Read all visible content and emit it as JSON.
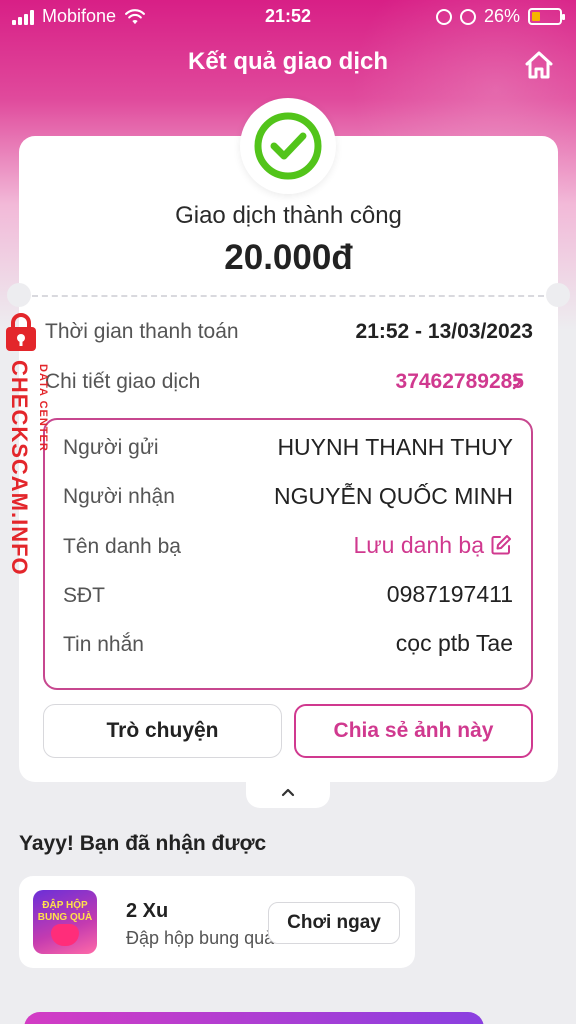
{
  "status_bar": {
    "carrier": "Mobifone",
    "time": "21:52",
    "battery_percent": "26%"
  },
  "header": {
    "title": "Kết quả giao dịch",
    "home_icon": "home-icon"
  },
  "result": {
    "status_icon": "check-circle-icon",
    "status_text": "Giao dịch thành công",
    "amount": "20.000đ"
  },
  "summary": {
    "time_label": "Thời gian thanh toán",
    "time_value": "21:52 - 13/03/2023",
    "detail_label": "Chi tiết giao dịch",
    "detail_value": "37462789285"
  },
  "details": {
    "sender_label": "Người gửi",
    "sender_value": "HUYNH THANH THUY",
    "receiver_label": "Người nhận",
    "receiver_value": "NGUYỄN QUỐC MINH",
    "contact_label": "Tên danh bạ",
    "contact_value": "Lưu danh bạ",
    "phone_label": "SĐT",
    "phone_value": "0987197411",
    "message_label": "Tin nhắn",
    "message_value": "cọc ptb Tae"
  },
  "actions": {
    "chat_label": "Trò chuyện",
    "share_label": "Chia sẻ ảnh này"
  },
  "reward": {
    "title": "Yayy! Bạn đã nhận được",
    "thumb_text": "ĐẬP HỘP BUNG QUÀ",
    "amount": "2 Xu",
    "description": "Đập hộp bung quà",
    "play_label": "Chơi ngay"
  },
  "watermark": {
    "text": "CHECKSCAM.INFO",
    "subtext": "DATA CENTER"
  },
  "colors": {
    "brand_pink": "#d0398f",
    "success_green": "#52c41a",
    "watermark_red": "#e3262b"
  }
}
